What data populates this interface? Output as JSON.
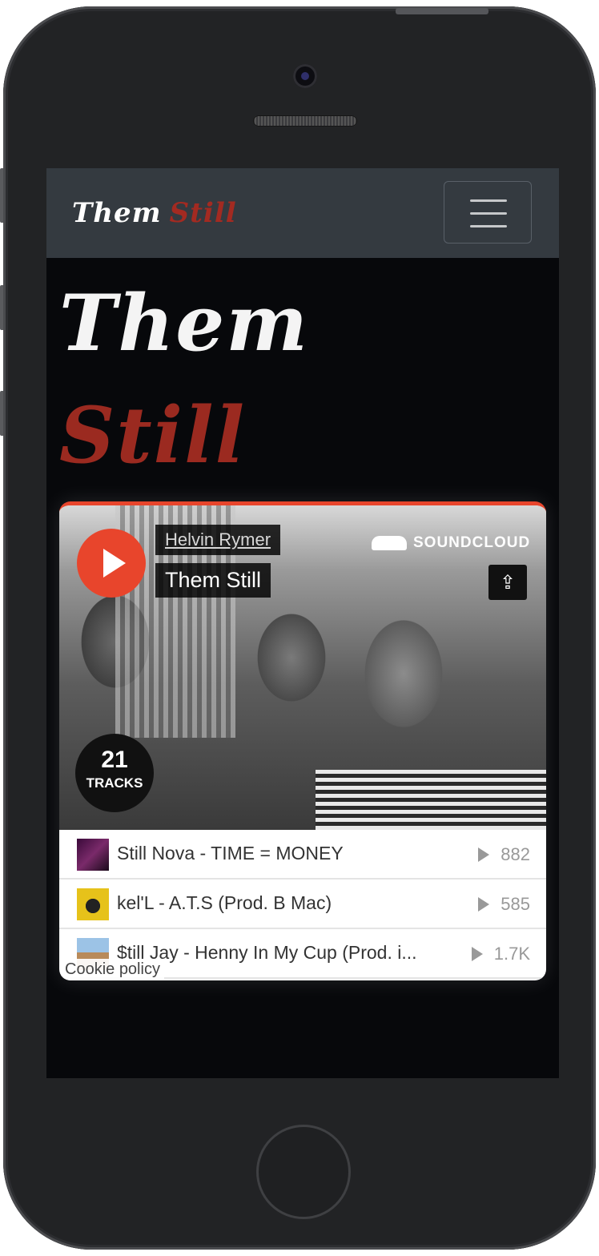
{
  "navbar": {
    "brand_word1": "Them",
    "brand_word2": "Still",
    "menu_icon": "hamburger-icon"
  },
  "hero": {
    "line1": "Them",
    "line2": "Still"
  },
  "player": {
    "artist": "Helvin Rymer",
    "title": "Them Still",
    "brand": "SOUNDCLOUD",
    "play_icon": "play-icon",
    "share_icon": "share-icon",
    "track_count": "21",
    "track_count_label": "TRACKS",
    "tracks": [
      {
        "title": "Still Nova - TIME = MONEY",
        "plays": "882"
      },
      {
        "title": "kel'L - A.T.S (Prod. B Mac)",
        "plays": "585"
      },
      {
        "title": "$till Jay - Henny In My Cup (Prod. i...",
        "plays": "1.7K"
      }
    ],
    "cookie_policy": "Cookie policy"
  },
  "colors": {
    "accent_red": "#9b2a20",
    "soundcloud_orange": "#e8452c",
    "navbar": "#343a40"
  }
}
